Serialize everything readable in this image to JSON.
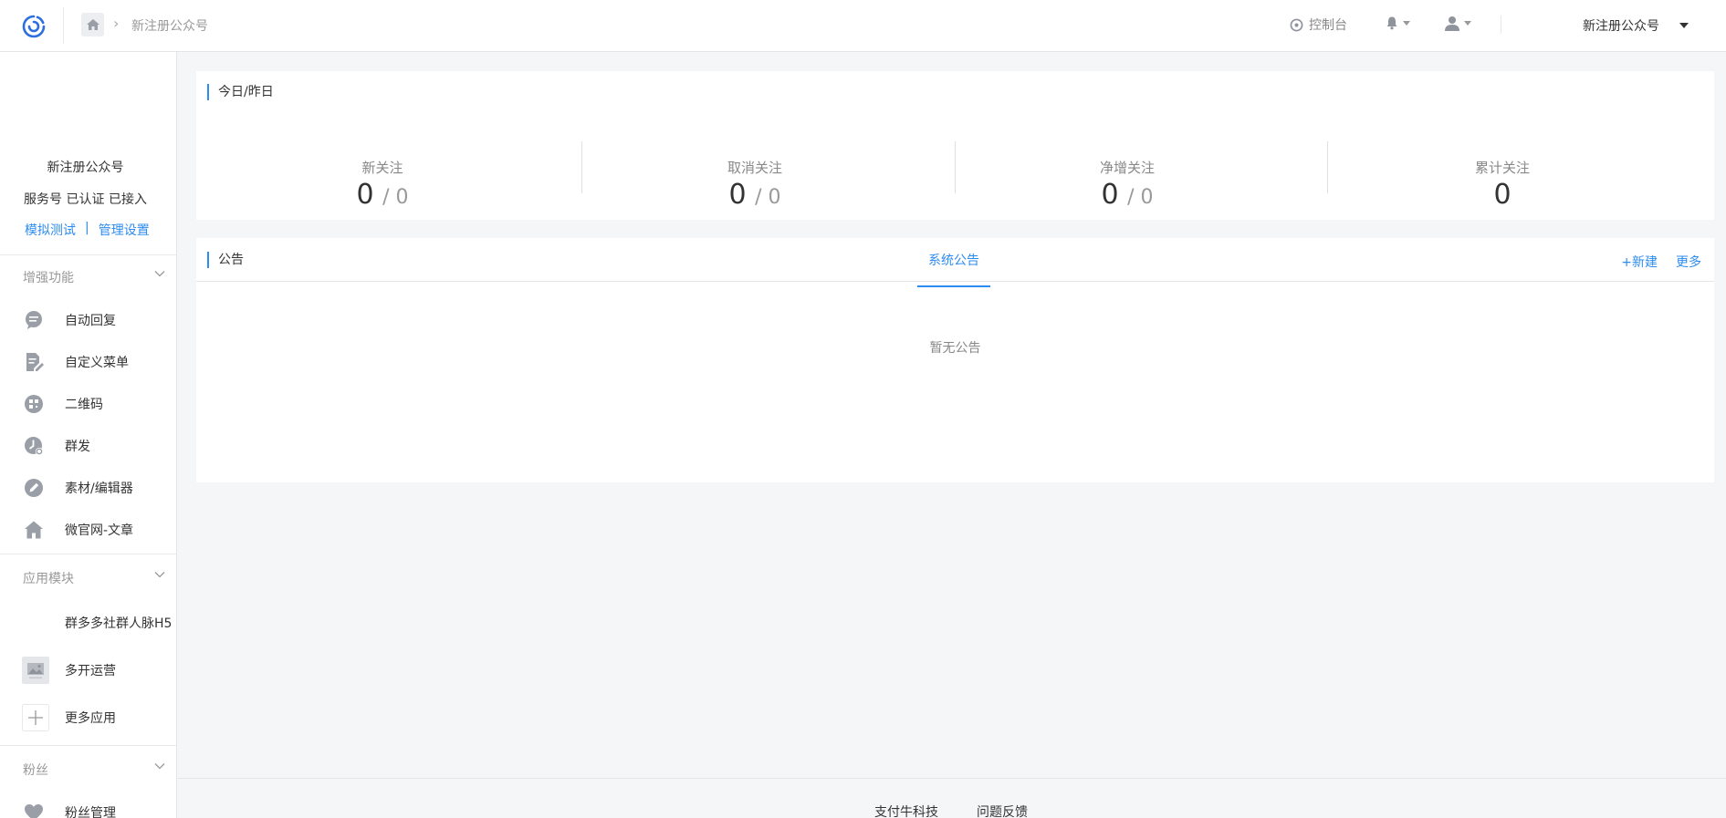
{
  "header": {
    "breadcrumb_current": "新注册公众号",
    "console_label": "控制台",
    "account_selector": "新注册公众号"
  },
  "sidebar": {
    "account_name": "新注册公众号",
    "account_status": "服务号 已认证 已接入",
    "link_test": "模拟测试",
    "link_separator": "|",
    "link_manage": "管理设置",
    "groups": [
      {
        "label": "增强功能"
      },
      {
        "label": "应用模块"
      },
      {
        "label": "粉丝"
      }
    ],
    "enhanced_items": [
      {
        "label": "自动回复",
        "icon": "chat-bubble-icon"
      },
      {
        "label": "自定义菜单",
        "icon": "edit-document-icon"
      },
      {
        "label": "二维码",
        "icon": "qrcode-icon"
      },
      {
        "label": "群发",
        "icon": "clock-icon"
      },
      {
        "label": "素材/编辑器",
        "icon": "pencil-icon"
      },
      {
        "label": "微官网-文章",
        "icon": "home-icon"
      }
    ],
    "app_items": [
      {
        "label": "群多多社群人脉H5",
        "icon": ""
      },
      {
        "label": "多开运营",
        "icon": "image-placeholder-icon"
      },
      {
        "label": "更多应用",
        "icon": "plus-icon"
      }
    ],
    "fans_items": [
      {
        "label": "粉丝管理",
        "icon": "heart-icon"
      }
    ]
  },
  "stats_panel": {
    "title": "今日/昨日",
    "stats": [
      {
        "label": "新关注",
        "today": "0",
        "yesterday": "/ 0"
      },
      {
        "label": "取消关注",
        "today": "0",
        "yesterday": "/ 0"
      },
      {
        "label": "净增关注",
        "today": "0",
        "yesterday": "/ 0"
      },
      {
        "label": "累计关注",
        "today": "0",
        "yesterday": ""
      }
    ]
  },
  "notice_panel": {
    "title": "公告",
    "tab_system": "系统公告",
    "new_link": "+新建",
    "more_link": "更多",
    "empty_message": "暂无公告"
  },
  "footer": {
    "company": "支付牛科技",
    "feedback": "问题反馈"
  },
  "colors": {
    "accent": "#2d8cf0",
    "background": "#f5f6f8",
    "icon_gray": "#9a9ea6"
  }
}
